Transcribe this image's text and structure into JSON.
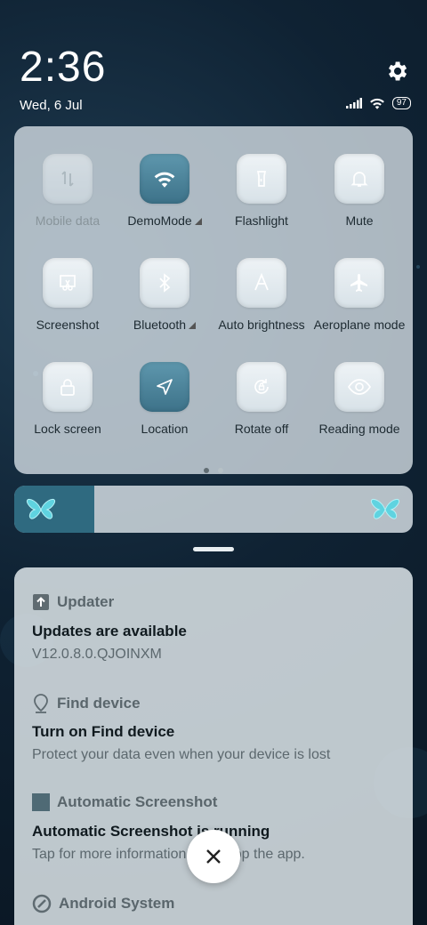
{
  "status_bar": {
    "time": "2:36",
    "date": "Wed, 6 Jul",
    "battery": "97"
  },
  "quick_settings": {
    "tiles": [
      {
        "label": "Mobile data",
        "icon": "mobile-data-icon",
        "state": "disabled"
      },
      {
        "label": "DemoMode",
        "icon": "wifi-icon",
        "state": "on",
        "expandable": true
      },
      {
        "label": "Flashlight",
        "icon": "flashlight-icon",
        "state": "off"
      },
      {
        "label": "Mute",
        "icon": "bell-icon",
        "state": "off"
      },
      {
        "label": "Screenshot",
        "icon": "screenshot-icon",
        "state": "off"
      },
      {
        "label": "Bluetooth",
        "icon": "bluetooth-icon",
        "state": "off",
        "expandable": true
      },
      {
        "label": "Auto brightness",
        "icon": "auto-brightness-icon",
        "state": "off"
      },
      {
        "label": "Aeroplane mode",
        "icon": "airplane-icon",
        "state": "off"
      },
      {
        "label": "Lock screen",
        "icon": "lock-icon",
        "state": "off"
      },
      {
        "label": "Location",
        "icon": "location-icon",
        "state": "on"
      },
      {
        "label": "Rotate off",
        "icon": "rotate-lock-icon",
        "state": "off"
      },
      {
        "label": "Reading mode",
        "icon": "eye-icon",
        "state": "off"
      }
    ],
    "page": 1,
    "page_count": 2
  },
  "brightness": {
    "level": 0.2,
    "accent": "#2f6a80"
  },
  "notifications": [
    {
      "app": "Updater",
      "icon": "upload-icon",
      "title": "Updates are available",
      "body": "V12.0.8.0.QJOINXM"
    },
    {
      "app": "Find device",
      "icon": "location-pin-icon",
      "title": "Turn on Find device",
      "body": "Protect your data even when your device is lost"
    },
    {
      "app": "Automatic Screenshot",
      "icon": "square-icon",
      "title": "Automatic Screenshot is running",
      "body": "Tap for more information or to stop the app."
    },
    {
      "app": "Android System",
      "icon": "android-icon",
      "title": "",
      "body": ""
    }
  ]
}
